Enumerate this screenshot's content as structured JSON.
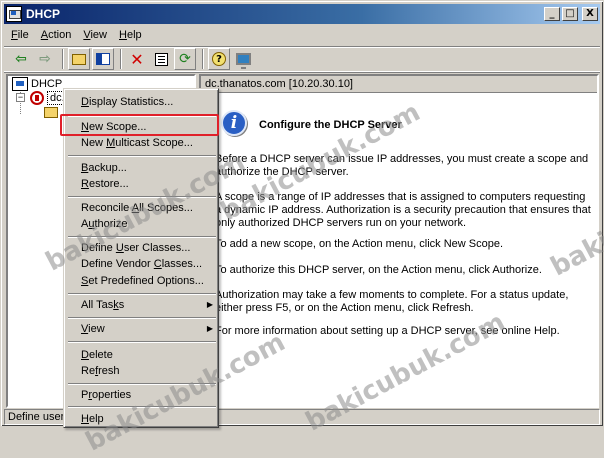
{
  "window": {
    "title": "DHCP"
  },
  "caption_buttons": {
    "minimize": "_",
    "maximize": "□",
    "close": "X"
  },
  "menubar": [
    {
      "label": "File",
      "key": "F",
      "rest": "ile"
    },
    {
      "label": "Action",
      "key": "A",
      "rest": "ction"
    },
    {
      "label": "View",
      "key": "V",
      "rest": "iew"
    },
    {
      "label": "Help",
      "key": "H",
      "rest": "elp"
    }
  ],
  "toolbar": {
    "icons": [
      "back-arrow-icon",
      "forward-arrow-icon",
      "up-folder-icon",
      "show-hide-tree-icon",
      "delete-icon",
      "properties-icon",
      "refresh-icon",
      "help-icon",
      "console-icon"
    ],
    "back": "⇦",
    "forward": "⇨",
    "delete": "✕",
    "refresh": "⟳",
    "help": "?"
  },
  "tree": {
    "root_label": "DHCP",
    "server_label": "dc.",
    "expander": "−"
  },
  "detail": {
    "header": "dc.thanatos.com [10.20.30.10]",
    "info_glyph": "i",
    "title": "Configure the DHCP Server",
    "p1": "Before a DHCP server can issue IP addresses, you must create a scope and authorize the DHCP server.",
    "p2": "A scope is a range of IP addresses that is assigned to computers requesting a dynamic IP address. Authorization is a security precaution that ensures that only authorized DHCP servers run on your network.",
    "p3": "To add a new scope, on the Action menu, click New Scope.",
    "p4": "To authorize this DHCP server, on the Action menu, click Authorize.",
    "p5": "Authorization may take a few moments to complete. For a status update, either press F5, or on the Action menu, click Refresh.",
    "p6": "For more information about setting up a DHCP server, see online Help."
  },
  "context_menu": {
    "display_statistics": {
      "pre": "",
      "key": "D",
      "post": "isplay Statistics..."
    },
    "new_scope": {
      "pre": "",
      "key": "N",
      "post": "ew Scope..."
    },
    "new_multicast_scope": {
      "pre": "New ",
      "key": "M",
      "post": "ulticast Scope..."
    },
    "backup": {
      "pre": "",
      "key": "B",
      "post": "ackup..."
    },
    "restore": {
      "pre": "",
      "key": "R",
      "post": "estore..."
    },
    "reconcile_all_scopes": {
      "pre": "Reconcile ",
      "key": "A",
      "post": "ll Scopes..."
    },
    "authorize": {
      "pre": "A",
      "key": "u",
      "post": "thorize"
    },
    "define_user_classes": {
      "pre": "Define ",
      "key": "U",
      "post": "ser Classes..."
    },
    "define_vendor_classes": {
      "pre": "Define Vendor ",
      "key": "C",
      "post": "lasses..."
    },
    "set_predefined_options": {
      "pre": "",
      "key": "S",
      "post": "et Predefined Options..."
    },
    "all_tasks": {
      "pre": "All Tas",
      "key": "k",
      "post": "s"
    },
    "view": {
      "pre": "",
      "key": "V",
      "post": "iew"
    },
    "delete": {
      "pre": "",
      "key": "D",
      "post": "elete"
    },
    "refresh": {
      "pre": "Re",
      "key": "f",
      "post": "resh"
    },
    "properties": {
      "pre": "P",
      "key": "r",
      "post": "operties"
    },
    "help": {
      "pre": "",
      "key": "H",
      "post": "elp"
    },
    "submenu_arrow": "▶"
  },
  "statusbar": {
    "text": "Define user"
  },
  "watermark": {
    "text": "bakicubuk.com",
    "side_text": "bakic"
  },
  "colors": {
    "title_start": "#0a246a",
    "title_end": "#a6caf0",
    "highlight": "#e0202a"
  }
}
